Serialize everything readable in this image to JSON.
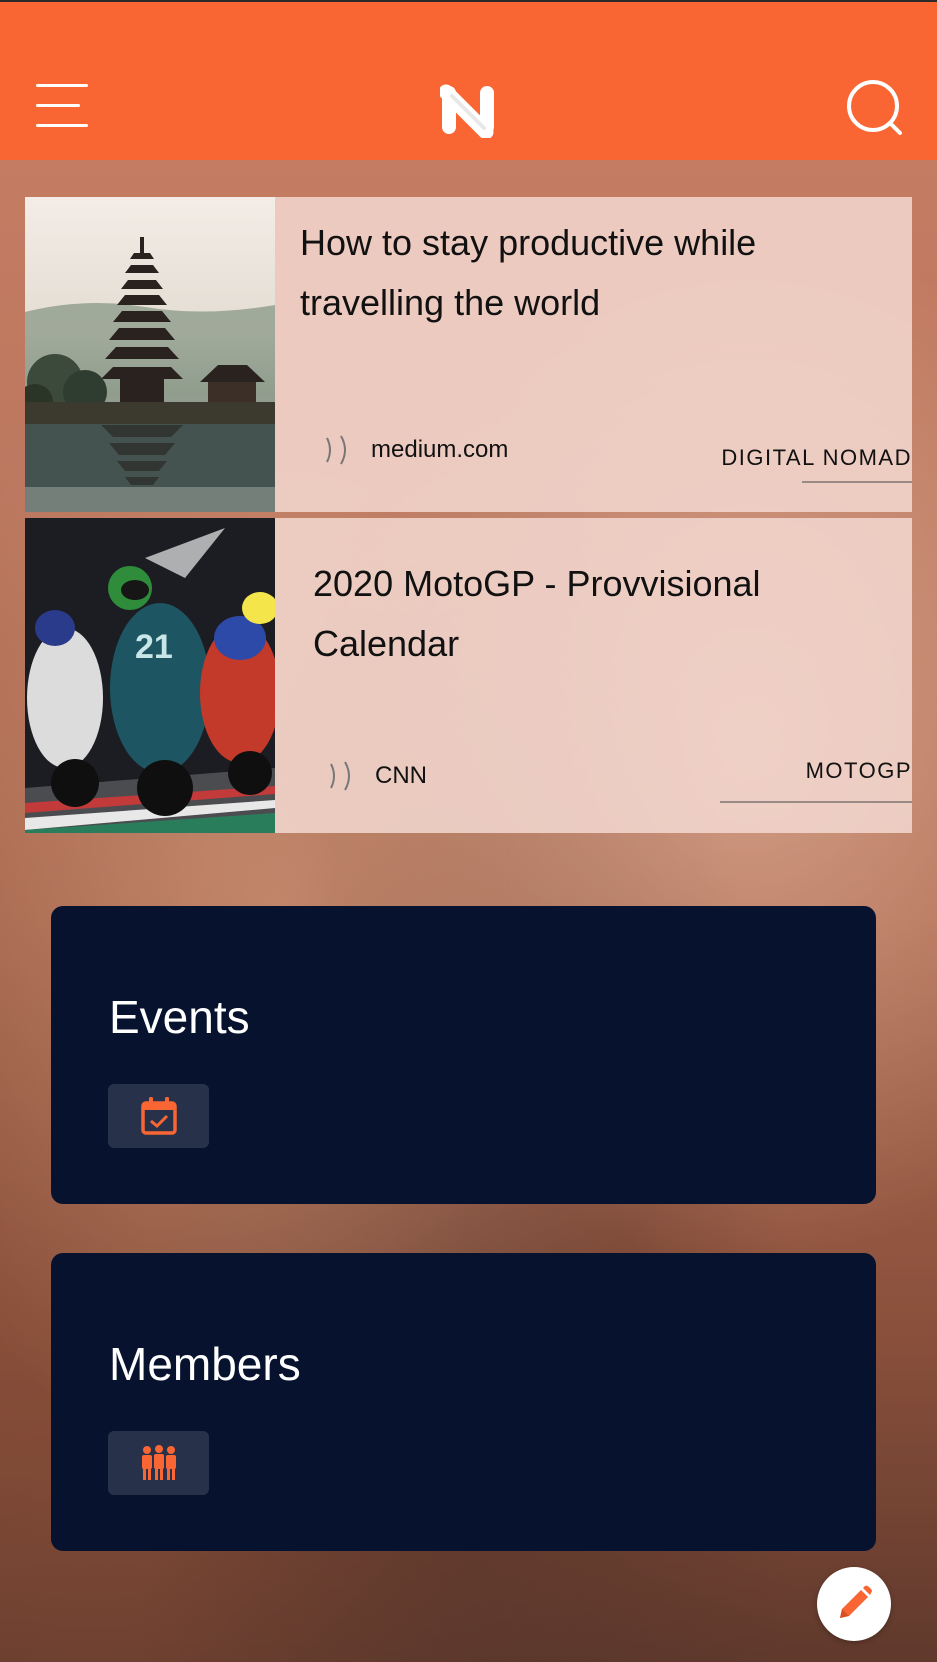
{
  "colors": {
    "accent": "#f96634",
    "header_bg": "#f96634",
    "section_bg": "#06122e",
    "badge_bg": "#27324a",
    "card_bg": "#f5dcd4"
  },
  "header": {
    "logo_letter": "N",
    "menu_icon": "hamburger-menu-icon",
    "search_icon": "search-icon"
  },
  "articles": [
    {
      "title": "How to stay productive while travelling the world",
      "source": "medium.com",
      "tag": "DIGITAL NOMAD",
      "thumbnail": "bali-temple-photo",
      "source_icon": "podcast-waves-icon"
    },
    {
      "title": "2020 MotoGP - Provvisional Calendar",
      "source": "CNN",
      "tag": "MOTOGP",
      "thumbnail": "motogp-race-photo",
      "source_icon": "podcast-waves-icon"
    }
  ],
  "sections": [
    {
      "title": "Events",
      "icon": "calendar-check-icon"
    },
    {
      "title": "Members",
      "icon": "group-people-icon"
    }
  ],
  "fab": {
    "icon": "pencil-edit-icon"
  }
}
